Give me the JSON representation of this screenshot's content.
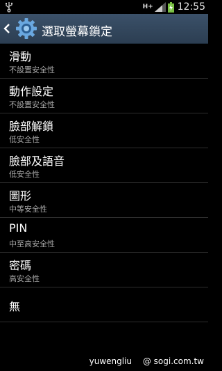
{
  "status_bar": {
    "network_type": "H+",
    "time": "12:55",
    "icons": [
      "usb-icon",
      "signal-icon",
      "battery-charging-icon"
    ]
  },
  "action_bar": {
    "title": "選取螢幕鎖定",
    "icons": [
      "back-arrow-icon",
      "settings-gear-icon"
    ]
  },
  "options": [
    {
      "title": "滑動",
      "subtitle": "不設置安全性"
    },
    {
      "title": "動作設定",
      "subtitle": "不設置安全性"
    },
    {
      "title": "臉部解鎖",
      "subtitle": "低安全性"
    },
    {
      "title": "臉部及語音",
      "subtitle": "低安全性"
    },
    {
      "title": "圖形",
      "subtitle": "中等安全性"
    },
    {
      "title": "PIN",
      "subtitle": "中至高安全性"
    },
    {
      "title": "密碼",
      "subtitle": "高安全性"
    },
    {
      "title": "無"
    }
  ],
  "watermark": {
    "user": "yuwengliu",
    "site": "@ sogi.com.tw"
  },
  "colors": {
    "action_bar": "#34485e",
    "background": "#000000",
    "battery": "#7ac143"
  }
}
